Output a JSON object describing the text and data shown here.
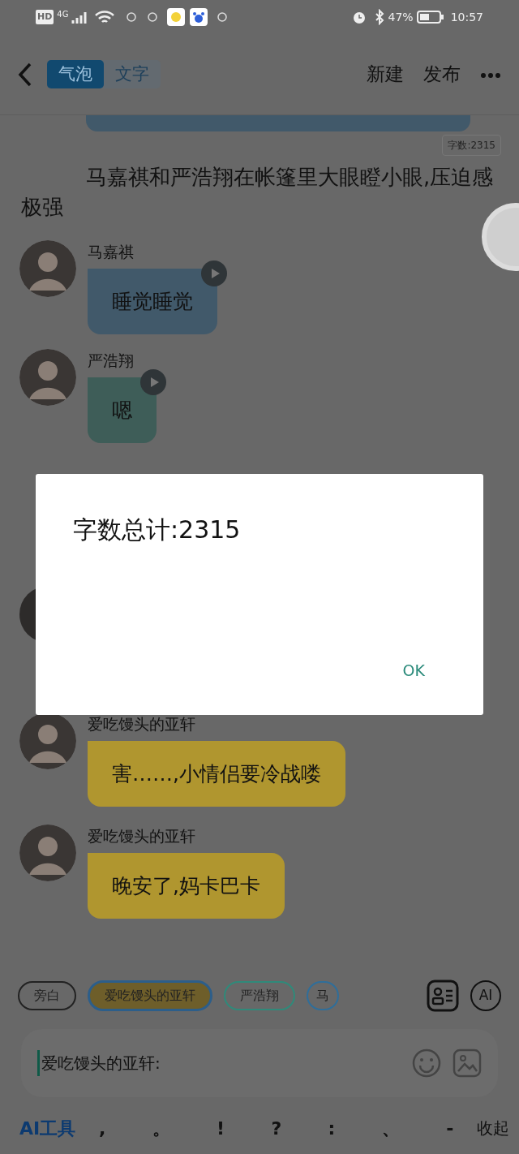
{
  "status_bar": {
    "network": [
      "HD",
      "4G"
    ],
    "battery": "47%",
    "time": "10:57"
  },
  "header": {
    "tabs": [
      {
        "label": "气泡",
        "selected": true
      },
      {
        "label": "文字",
        "selected": false
      }
    ],
    "actions": [
      "新建",
      "发布"
    ]
  },
  "word_count_tag": "字数:2315",
  "narration": "马嘉祺和严浩翔在帐篷里大眼瞪小眼,压迫感极强",
  "messages": [
    {
      "name": "马嘉祺",
      "text": "睡觉睡觉",
      "color": "#41596a",
      "voice": true
    },
    {
      "name": "严浩翔",
      "text": "嗯",
      "color": "#3e5d58",
      "voice": true
    },
    {
      "name": "爱吃馒头的亚轩",
      "text": "害……,小情侣要冷战喽",
      "color": "#b0962f",
      "voice": false
    },
    {
      "name": "爱吃馒头的亚轩",
      "text": "晚安了,妈卡巴卡",
      "color": "#b0962f",
      "voice": false
    }
  ],
  "dialog": {
    "text": "字数总计:2315",
    "button": "OK"
  },
  "role_chips": [
    {
      "label": "旁白",
      "selected": false,
      "color": "#222222"
    },
    {
      "label": "爱吃馒头的亚轩",
      "selected": true,
      "color": "#2c5e8a"
    },
    {
      "label": "严浩翔",
      "selected": false,
      "color": "#2f8a7a"
    },
    {
      "label": "马",
      "selected": false,
      "color": "#2f6e9a"
    }
  ],
  "ai_button": "AI",
  "input": {
    "value": "爱吃馒头的亚轩:"
  },
  "toolbar": {
    "ai_label": "AI工具",
    "punctuation": [
      ",",
      "。",
      "!",
      "?",
      ":",
      "、",
      "-"
    ],
    "collapse": "收起"
  }
}
